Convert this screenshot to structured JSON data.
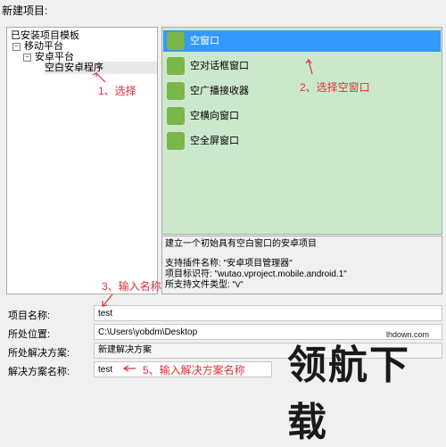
{
  "dialog": {
    "title": "新建项目:"
  },
  "tree": {
    "root": "已安装项目模板",
    "mobile": "移动平台",
    "android": "安卓平台",
    "blank_android": "空白安卓程序"
  },
  "templates": [
    {
      "label": "空窗口"
    },
    {
      "label": "空对话框窗口"
    },
    {
      "label": "空广播接收器"
    },
    {
      "label": "空横向窗口"
    },
    {
      "label": "空全屏窗口"
    }
  ],
  "description": {
    "line1": "建立一个初始具有空白窗口的安卓项目",
    "line2": "支持插件名称: \"安卓项目管理器\"",
    "line3": "项目标识符: \"wutao.vproject.mobile.android.1\"",
    "line4": "所支持文件类型: \"v\""
  },
  "form": {
    "project_name_label": "项目名称:",
    "project_name_value": "test",
    "location_label": "所处位置:",
    "location_value": "C:\\Users\\yobdm\\Desktop",
    "solution_label": "所处解决方案:",
    "solution_value": "新建解决方案",
    "solution_name_label": "解决方案名称:",
    "solution_name_value": "test"
  },
  "annotations": {
    "step1": "1、选择",
    "step2": "2、选择空窗口",
    "step3": "3、输入名称",
    "step5": "5、输入解决方案名称"
  },
  "watermark": {
    "main": "领航下载",
    "sub": "lhdown.com"
  },
  "colors": {
    "selected": "#3399ff",
    "list_bg": "#cce8cc",
    "annotation": "#e0303a",
    "icon": "#7ab648"
  }
}
